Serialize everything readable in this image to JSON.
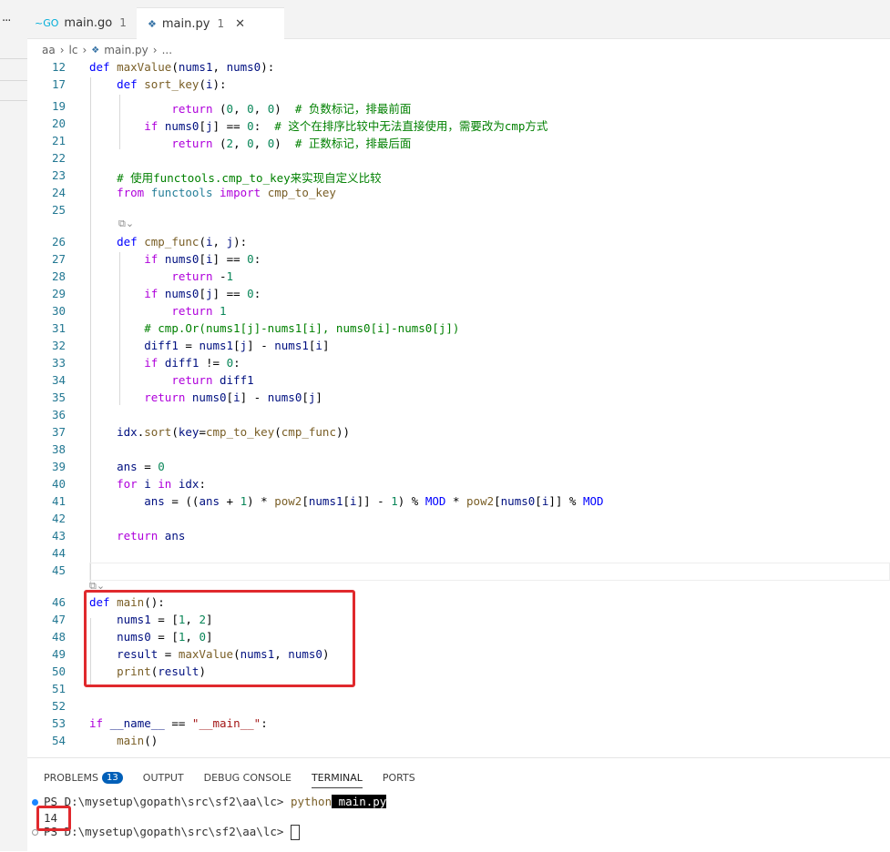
{
  "tabs": [
    {
      "icon": "~GO",
      "name": "main.go",
      "problems": "1"
    },
    {
      "icon": "python-icon",
      "name": "main.py",
      "problems": "1"
    }
  ],
  "breadcrumb": [
    "aa",
    "lc",
    "main.py",
    "..."
  ],
  "code_lines": [
    {
      "n": "12",
      "text": "def maxValue(nums1, nums0):"
    },
    {
      "n": "17",
      "text": "    def sort_key(i):"
    },
    {
      "n": "19",
      "text": "            return (0, 0, 0)  # 负数标记，排最前面"
    },
    {
      "n": "20",
      "text": "        if nums0[j] == 0:  # 这个在排序比较中无法直接使用，需要改为cmp方式"
    },
    {
      "n": "21",
      "text": "            return (2, 0, 0)  # 正数标记，排最后面"
    },
    {
      "n": "22",
      "text": ""
    },
    {
      "n": "23",
      "text": "    # 使用functools.cmp_to_key来实现自定义比较"
    },
    {
      "n": "24",
      "text": "    from functools import cmp_to_key"
    },
    {
      "n": "25",
      "text": ""
    },
    {
      "n": "26",
      "text": "    def cmp_func(i, j):"
    },
    {
      "n": "27",
      "text": "        if nums0[i] == 0:"
    },
    {
      "n": "28",
      "text": "            return -1"
    },
    {
      "n": "29",
      "text": "        if nums0[j] == 0:"
    },
    {
      "n": "30",
      "text": "            return 1"
    },
    {
      "n": "31",
      "text": "        # cmp.Or(nums1[j]-nums1[i], nums0[i]-nums0[j])"
    },
    {
      "n": "32",
      "text": "        diff1 = nums1[j] - nums1[i]"
    },
    {
      "n": "33",
      "text": "        if diff1 != 0:"
    },
    {
      "n": "34",
      "text": "            return diff1"
    },
    {
      "n": "35",
      "text": "        return nums0[i] - nums0[j]"
    },
    {
      "n": "36",
      "text": ""
    },
    {
      "n": "37",
      "text": "    idx.sort(key=cmp_to_key(cmp_func))"
    },
    {
      "n": "38",
      "text": ""
    },
    {
      "n": "39",
      "text": "    ans = 0"
    },
    {
      "n": "40",
      "text": "    for i in idx:"
    },
    {
      "n": "41",
      "text": "        ans = ((ans + 1) * pow2[nums1[i]] - 1) % MOD * pow2[nums0[i]] % MOD"
    },
    {
      "n": "42",
      "text": ""
    },
    {
      "n": "43",
      "text": "    return ans"
    },
    {
      "n": "44",
      "text": ""
    },
    {
      "n": "45",
      "text": ""
    },
    {
      "n": "46",
      "text": "def main():"
    },
    {
      "n": "47",
      "text": "    nums1 = [1, 2]"
    },
    {
      "n": "48",
      "text": "    nums0 = [1, 0]"
    },
    {
      "n": "49",
      "text": "    result = maxValue(nums1, nums0)"
    },
    {
      "n": "50",
      "text": "    print(result)"
    },
    {
      "n": "51",
      "text": ""
    },
    {
      "n": "52",
      "text": ""
    },
    {
      "n": "53",
      "text": "if __name__ == \"__main__\":"
    },
    {
      "n": "54",
      "text": "    main()"
    }
  ],
  "panel": {
    "tabs": [
      "PROBLEMS",
      "OUTPUT",
      "DEBUG CONSOLE",
      "TERMINAL",
      "PORTS"
    ],
    "problems_count": "13",
    "active": "TERMINAL"
  },
  "terminal": {
    "prompt": "PS D:\\mysetup\\gopath\\src\\sf2\\aa\\lc> ",
    "command": "python",
    "arg": " main.py",
    "output": "14"
  },
  "colors": {
    "highlight_box": "#e0292d",
    "badge": "#005fb8",
    "keyword": "#0000ff",
    "comment": "#008000"
  }
}
